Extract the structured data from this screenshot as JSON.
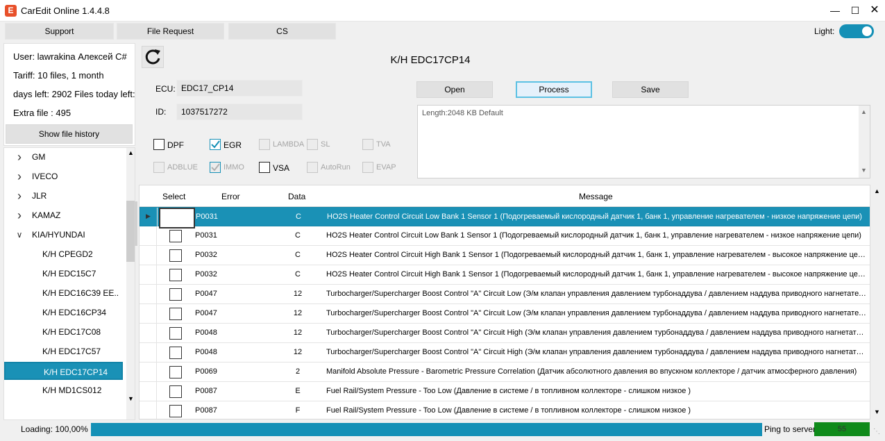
{
  "window": {
    "title": "CarEdit Online 1.4.4.8",
    "logo_letter": "E"
  },
  "nav": {
    "support": "Support",
    "file_request": "File Request",
    "cs": "CS",
    "light_label": "Light:",
    "light_on": true
  },
  "user": {
    "user_line": "User: lawrakina Алексей C#",
    "tariff_line": "Tariff: 10 files, 1 month",
    "days_line": "days left: 2902 Files today left:",
    "extra_line": "Extra file : 495",
    "history_button": "Show file history"
  },
  "tree": {
    "nodes": [
      {
        "label": "GM",
        "level": 0,
        "expanded": false
      },
      {
        "label": "IVECO",
        "level": 0,
        "expanded": false
      },
      {
        "label": "JLR",
        "level": 0,
        "expanded": false
      },
      {
        "label": "KAMAZ",
        "level": 0,
        "expanded": false
      },
      {
        "label": "KIA/HYUNDAI",
        "level": 0,
        "expanded": true
      },
      {
        "label": "K/H CPEGD2",
        "level": 1
      },
      {
        "label": "K/H EDC15C7",
        "level": 1
      },
      {
        "label": "K/H  EDC16C39  EE..",
        "level": 1
      },
      {
        "label": "K/H EDC16CP34",
        "level": 1
      },
      {
        "label": "K/H EDC17C08",
        "level": 1
      },
      {
        "label": "K/H EDC17C57",
        "level": 1
      },
      {
        "label": "K/H EDC17CP14",
        "level": 1,
        "selected": true
      },
      {
        "label": "K/H MD1CS012",
        "level": 1
      }
    ]
  },
  "main": {
    "ecu_title": "K/H EDC17CP14",
    "ecu_label": "ECU:",
    "ecu_value": "EDC17_CP14",
    "id_label": "ID:",
    "id_value": "1037517272",
    "open_button": "Open",
    "process_button": "Process",
    "save_button": "Save",
    "log_text": "Length:2048 KB  Default"
  },
  "options": [
    {
      "label": "DPF",
      "checked": false,
      "disabled": false
    },
    {
      "label": "EGR",
      "checked": true,
      "disabled": false
    },
    {
      "label": "LAMBDA",
      "checked": false,
      "disabled": true
    },
    {
      "label": "SL",
      "checked": false,
      "disabled": true
    },
    {
      "label": "TVA",
      "checked": false,
      "disabled": true
    },
    {
      "label": "ADBLUE",
      "checked": false,
      "disabled": true
    },
    {
      "label": "IMMO",
      "checked": true,
      "disabled": true
    },
    {
      "label": "VSA",
      "checked": false,
      "disabled": false
    },
    {
      "label": "AutoRun",
      "checked": false,
      "disabled": true
    },
    {
      "label": "EVAP",
      "checked": false,
      "disabled": true
    }
  ],
  "grid": {
    "columns": {
      "select": "Select",
      "error": "Error",
      "data": "Data",
      "message": "Message"
    },
    "rows": [
      {
        "error": "P0031",
        "data": "C",
        "message": "HO2S Heater Control Circuit Low Bank 1 Sensor 1 (Подогреваемый кислородный датчик 1, банк 1, управление нагревателем - низкое напряжение цепи)",
        "selected": true
      },
      {
        "error": "P0031",
        "data": "C",
        "message": "HO2S Heater Control Circuit Low Bank 1 Sensor 1 (Подогреваемый кислородный датчик 1, банк 1, управление нагревателем - низкое напряжение цепи)"
      },
      {
        "error": "P0032",
        "data": "C",
        "message": "HO2S Heater Control Circuit High Bank 1 Sensor 1 (Подогреваемый кислородный датчик 1, банк 1, управление нагревателем - высокое напряжение цепи)"
      },
      {
        "error": "P0032",
        "data": "C",
        "message": "HO2S Heater Control Circuit High Bank 1 Sensor 1 (Подогреваемый кислородный датчик 1, банк 1, управление нагревателем - высокое напряжение цепи)"
      },
      {
        "error": "P0047",
        "data": "12",
        "message": "Turbocharger/Supercharger Boost Control \"A\" Circuit Low (Э/м клапан управления давлением турбонаддува / давлением наддува приводного нагнетателя)"
      },
      {
        "error": "P0047",
        "data": "12",
        "message": "Turbocharger/Supercharger Boost Control \"A\" Circuit Low (Э/м клапан управления давлением турбонаддува / давлением наддува приводного нагнетателя)"
      },
      {
        "error": "P0048",
        "data": "12",
        "message": "Turbocharger/Supercharger Boost Control \"A\" Circuit High (Э/м клапан управления давлением турбонаддува / давлением наддува приводного нагнетателя)"
      },
      {
        "error": "P0048",
        "data": "12",
        "message": "Turbocharger/Supercharger Boost Control \"A\" Circuit High (Э/м клапан управления давлением турбонаддува / давлением наддува приводного нагнетателя)"
      },
      {
        "error": "P0069",
        "data": "2",
        "message": "Manifold Absolute Pressure - Barometric Pressure Correlation (Датчик абсолютного давления во впускном коллекторе / датчик атмосферного давления)"
      },
      {
        "error": "P0087",
        "data": "E",
        "message": "Fuel Rail/System Pressure - Too Low (Давление в системе / в топливном коллекторе - слишком низкое )"
      },
      {
        "error": "P0087",
        "data": "F",
        "message": "Fuel Rail/System Pressure - Too Low (Давление в системе / в топливном коллекторе - слишком низкое )"
      }
    ]
  },
  "status": {
    "loading": "Loading: 100,00%",
    "progress_fraction": 1.0,
    "ping_label": "Ping to server",
    "ping_value": "55"
  },
  "colors": {
    "accent": "#1590b6",
    "ping_ok": "#0f8a1a",
    "logo": "#e8502a"
  }
}
